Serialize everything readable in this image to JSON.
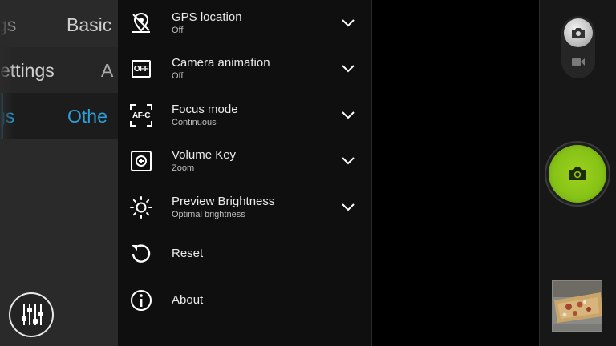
{
  "category_tabs": {
    "rows": [
      {
        "partial_left": "gs",
        "partial_right": "Basic"
      },
      {
        "partial_left": "ettings",
        "partial_right": "A"
      },
      {
        "partial_left": "gs",
        "partial_right": "Othe"
      }
    ],
    "active_index": 2,
    "accent_color": "#2a9fd8"
  },
  "menu": {
    "items": [
      {
        "icon": "gps-location-icon",
        "title": "GPS location",
        "value": "Off",
        "expandable": true
      },
      {
        "icon": "off-badge-icon",
        "icon_text": "OFF",
        "title": "Camera animation",
        "value": "Off",
        "expandable": true
      },
      {
        "icon": "af-c-focus-icon",
        "icon_text": "AF-C",
        "title": "Focus mode",
        "value": "Continuous",
        "expandable": true
      },
      {
        "icon": "volume-key-icon",
        "title": "Volume Key",
        "value": "Zoom",
        "expandable": true
      },
      {
        "icon": "brightness-sun-icon",
        "title": "Preview Brightness",
        "value": "Optimal brightness",
        "expandable": true
      },
      {
        "icon": "reset-icon",
        "title": "Reset",
        "expandable": false
      },
      {
        "icon": "info-icon",
        "title": "About",
        "expandable": false
      }
    ]
  },
  "controls": {
    "mode": "photo",
    "shutter_color": "#8cc418",
    "icons": [
      "tune-settings-icon",
      "photo-mode-icon",
      "video-mode-icon",
      "shutter-camera-icon",
      "gallery-thumbnail"
    ]
  }
}
